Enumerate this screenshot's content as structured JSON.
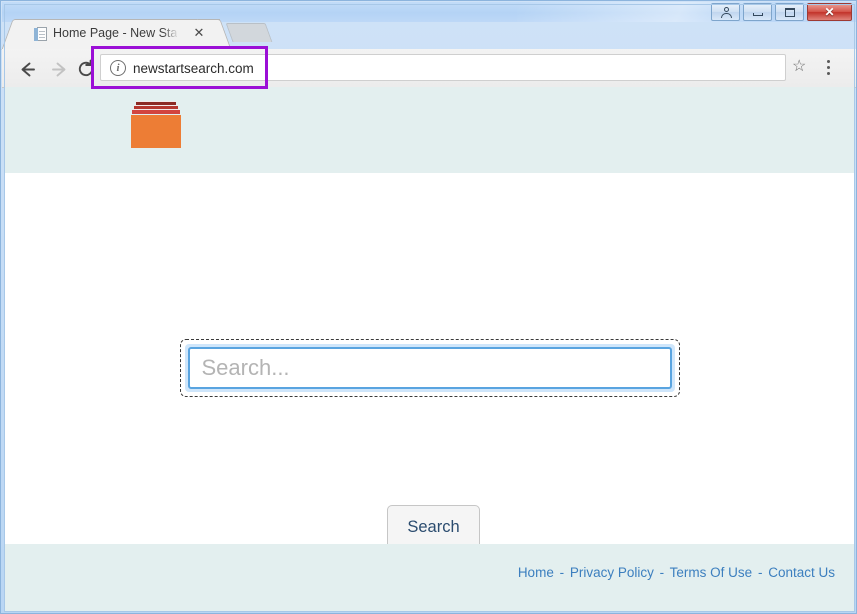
{
  "window": {
    "controls": [
      {
        "name": "user-account-button",
        "icon": "user-icon",
        "label": ""
      },
      {
        "name": "minimize-button",
        "icon": "minimize-icon",
        "label": ""
      },
      {
        "name": "maximize-button",
        "icon": "maximize-icon",
        "label": ""
      },
      {
        "name": "close-button",
        "icon": "close-icon",
        "label": "✕"
      }
    ]
  },
  "tabstrip": {
    "tab_title": "Home Page - New Start S",
    "tab_close_label": "✕",
    "favicon": "page-favicon",
    "new_tab_label": ""
  },
  "toolbar": {
    "back_label": "←",
    "forward_label": "→",
    "reload_label": "⟳",
    "security_icon_label": "i",
    "url": "newstartsearch.com",
    "bookmark_label": "☆",
    "menu_label": ""
  },
  "annotation": {
    "highlight_color": "#9b0fd6",
    "highlight_target": "address-bar"
  },
  "page": {
    "logo_alt": "newstartsearch-logo",
    "search": {
      "value": "",
      "placeholder": "Search...",
      "button_label": "Search"
    },
    "footer": {
      "separator": "-",
      "links": [
        {
          "label": "Home"
        },
        {
          "label": "Privacy Policy"
        },
        {
          "label": "Terms Of Use"
        },
        {
          "label": "Contact Us"
        }
      ]
    }
  },
  "colors": {
    "titlebar": "#b4d3f5",
    "page_band": "#e3efef",
    "logo_orange": "#ed7d35",
    "logo_red": "#d2453f",
    "link_blue": "#3c7fbf",
    "focus_blue": "#59a4e0"
  }
}
